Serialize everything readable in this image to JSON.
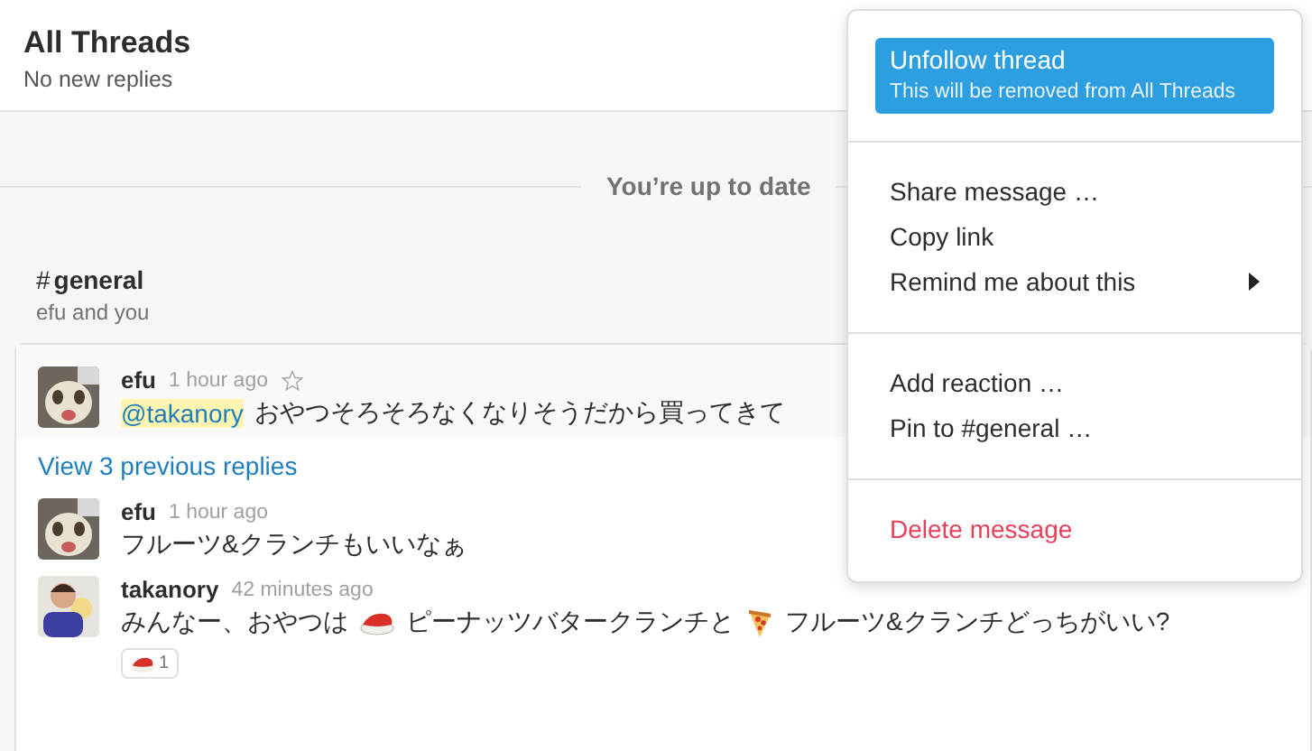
{
  "header": {
    "title": "All Threads",
    "subtitle": "No new replies"
  },
  "divider": "You’re up to date",
  "channel": {
    "hash": "#",
    "name": "general",
    "members": "efu and you"
  },
  "root": {
    "author": "efu",
    "time": "1 hour ago",
    "starred": false,
    "segments": [
      {
        "kind": "mention",
        "text": "@takanory"
      },
      {
        "kind": "text",
        "text": "おやつそろそろなくなりそうだから買ってきて"
      }
    ]
  },
  "view_replies": "View 3 previous replies",
  "replies": [
    {
      "author": "efu",
      "time": "1 hour ago",
      "segments": [
        {
          "kind": "text",
          "text": "フルーツ&クランチもいいなぁ"
        }
      ]
    },
    {
      "author": "takanory",
      "time": "42 minutes ago",
      "segments": [
        {
          "kind": "text",
          "text": "みんなー、おやつは"
        },
        {
          "kind": "sushi"
        },
        {
          "kind": "text",
          "text": "ピーナッツバタークランチと"
        },
        {
          "kind": "pizza"
        },
        {
          "kind": "text",
          "text": "フルーツ&クランチどっちがいい?"
        }
      ],
      "reactions": [
        {
          "kind": "sushi",
          "count": "1"
        }
      ]
    }
  ],
  "menu": {
    "groups": [
      [
        {
          "label": "Unfollow thread",
          "hint": "This will be removed from All Threads",
          "selected": true,
          "kind": "normal",
          "has_submenu": false
        }
      ],
      [
        {
          "label": "Share message …",
          "selected": false,
          "kind": "normal",
          "has_submenu": false
        },
        {
          "label": "Copy link",
          "selected": false,
          "kind": "normal",
          "has_submenu": false
        },
        {
          "label": "Remind me about this",
          "selected": false,
          "kind": "normal",
          "has_submenu": true
        }
      ],
      [
        {
          "label": "Add reaction …",
          "selected": false,
          "kind": "normal",
          "has_submenu": false
        },
        {
          "label": "Pin to #general …",
          "selected": false,
          "kind": "normal",
          "has_submenu": false
        }
      ],
      [
        {
          "label": "Delete message",
          "selected": false,
          "kind": "danger",
          "has_submenu": false
        }
      ]
    ]
  }
}
